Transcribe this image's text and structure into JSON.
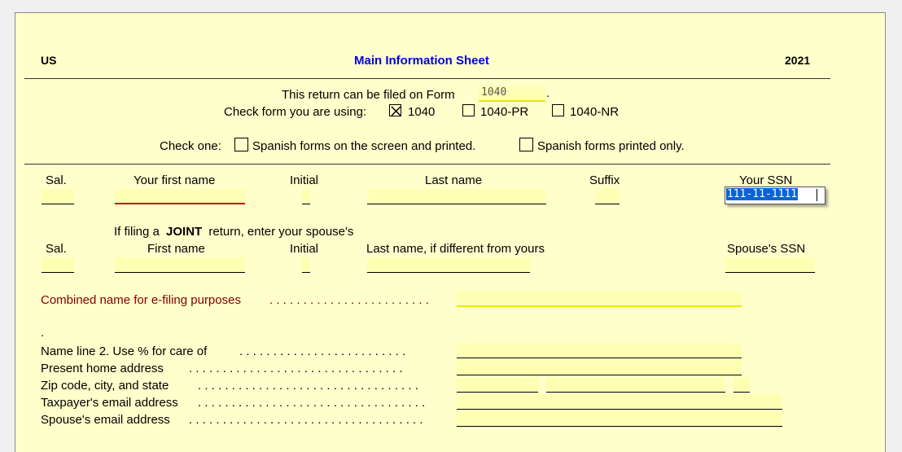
{
  "header": {
    "left": "US",
    "title": "Main Information Sheet",
    "year": "2021"
  },
  "filing": {
    "prompt": "This return can be filed on Form",
    "form_value": "1040",
    "period": ".",
    "check_prompt": "Check form you are using:",
    "options": [
      {
        "label": "1040",
        "checked": true
      },
      {
        "label": "1040-PR",
        "checked": false
      },
      {
        "label": "1040-NR",
        "checked": false
      }
    ]
  },
  "spanish": {
    "prompt": "Check one:",
    "options": [
      {
        "label": "Spanish forms on the screen and printed.",
        "checked": false
      },
      {
        "label": "Spanish forms printed only.",
        "checked": false
      }
    ]
  },
  "taxpayer": {
    "sal": "Sal.",
    "first": "Your first name",
    "initial": "Initial",
    "last": "Last name",
    "suffix": "Suffix",
    "ssn_label": "Your SSN",
    "ssn_value": "111-11-1111"
  },
  "spouse": {
    "intro_pre": "If filing a",
    "intro_bold": "JOINT",
    "intro_post": "return, enter your spouse's",
    "sal": "Sal.",
    "first": "First name",
    "initial": "Initial",
    "last": "Last name, if different from yours",
    "ssn_label": "Spouse's SSN"
  },
  "combined": {
    "label": "Combined name for e-filing purposes",
    "dots": ". . . . . . . . . . . . . . . . . . . . . . . ."
  },
  "address": {
    "bullet": ".",
    "rows": [
      {
        "label": "Name line 2.  Use % for care of",
        "dots": ". . . . . . . . . . . . . . . . . . . . . . . . ."
      },
      {
        "label": "Present home address",
        "dots": ". . . . . . . . . . . . . . . . . . . . . . . . . . . . . . . ."
      },
      {
        "label": "Zip code,  city,  and state",
        "dots": ". . . . . . . . . . . . . . . . . . . . . . . . . . . . . . . . ."
      },
      {
        "label": "Taxpayer's email address",
        "dots": ". . . . . . . . . . . . . . . . . . . . . . . . . . . . . . . . . ."
      },
      {
        "label": "Spouse's email address",
        "dots": ". . . . . . . . . . . . . . . . . . . . . . . . . . . . . . . . . . ."
      }
    ]
  },
  "colors": {
    "title": "#0000e6",
    "field": "#ffffb4",
    "sheet": "#ffffcc",
    "maroon": "#800000",
    "selection": "#0a64d8"
  }
}
